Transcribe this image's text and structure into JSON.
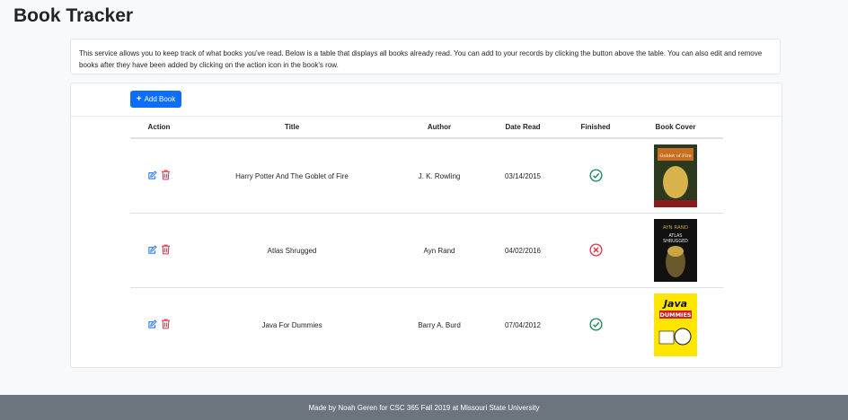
{
  "app": {
    "title": "Book Tracker"
  },
  "intro": {
    "text": "This service allows you to keep track of what books you've read. Below is a table that displays all books already read. You can add to your records by clicking the button above the table. You can also edit and remove books after they have been added by clicking on the action icon in the book's row."
  },
  "toolbar": {
    "add_label": "Add Book",
    "add_icon": "plus-icon"
  },
  "table": {
    "headers": {
      "action": "Action",
      "title": "Title",
      "author": "Author",
      "date_read": "Date Read",
      "finished": "Finished",
      "cover": "Book Cover"
    },
    "rows": [
      {
        "title": "Harry Potter And The Goblet of Fire",
        "author": "J. K. Rowling",
        "date_read": "03/14/2015",
        "finished": true,
        "cover": {
          "line1": "Goblet of Fire",
          "line2": "",
          "colors": [
            "#2b3a1f",
            "#c8701f",
            "#d8b24a"
          ]
        }
      },
      {
        "title": "Atlas Shrugged",
        "author": "Ayn Rand",
        "date_read": "04/02/2016",
        "finished": false,
        "cover": {
          "line1": "AYN RAND",
          "line2": "ATLAS SHRUGGED",
          "colors": [
            "#111111",
            "#c9a443",
            "#6a5a2b"
          ]
        }
      },
      {
        "title": "Java For Dummies",
        "author": "Barry A. Burd",
        "date_read": "07/04/2012",
        "finished": true,
        "cover": {
          "line1": "Java",
          "line2": "DUMMIES",
          "colors": [
            "#ffe600",
            "#111111",
            "#d11d1d"
          ]
        }
      }
    ]
  },
  "footer": {
    "text": "Made by Noah Geren for CSC 365 Fall 2019 at Missouri State University"
  },
  "colors": {
    "primary": "#0d6efd",
    "edit_icon": "#0d6efd",
    "delete_icon": "#dc3545",
    "finished": "#198754",
    "unfinished": "#dc3545",
    "footer_bg": "#6c757d"
  }
}
